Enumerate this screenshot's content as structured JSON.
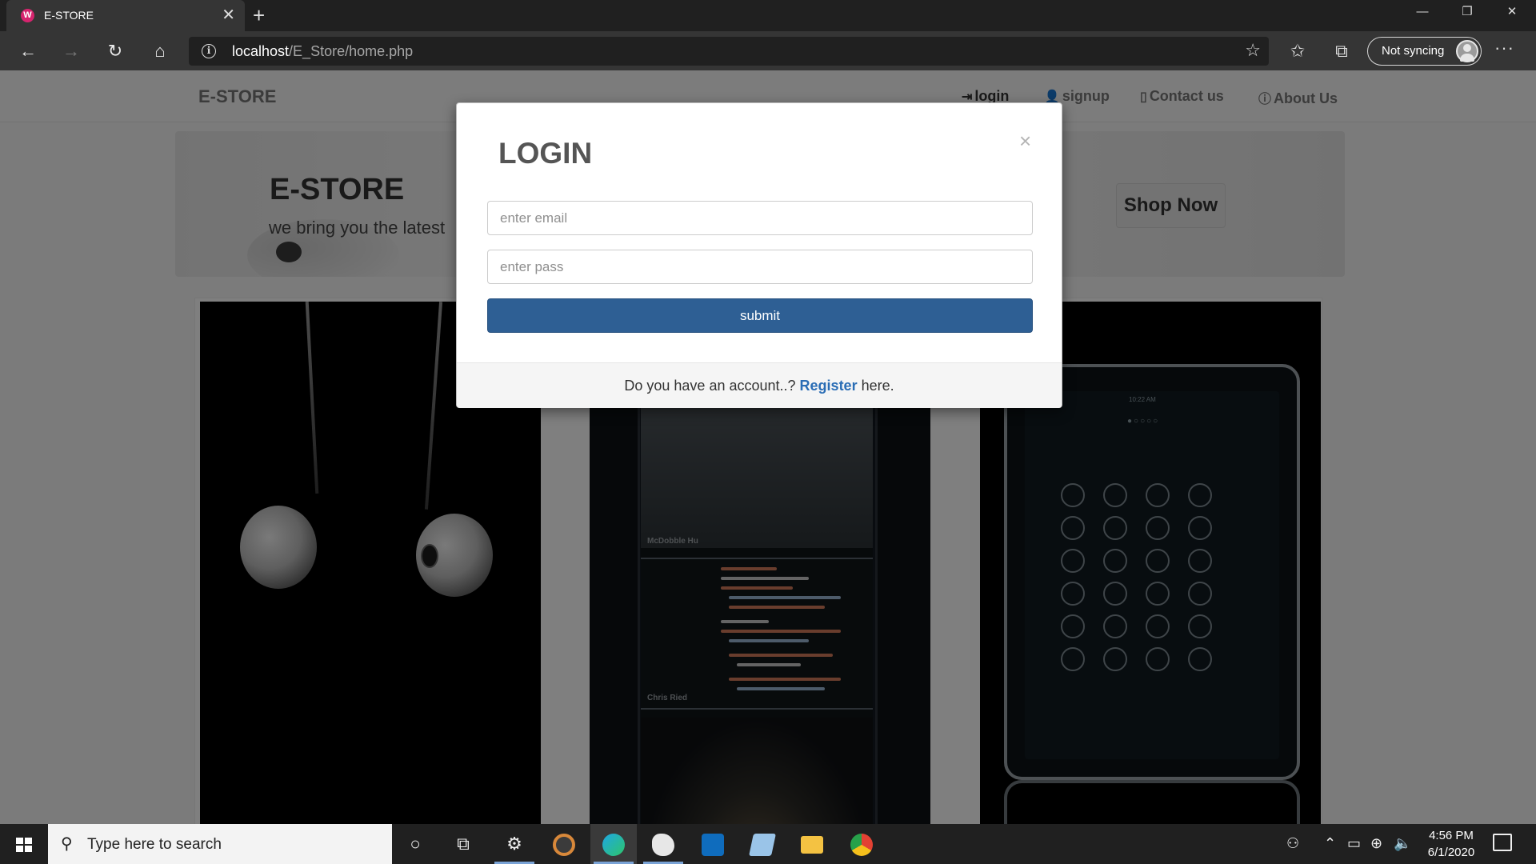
{
  "browser": {
    "tab_title": "E-STORE",
    "favicon_letter": "W",
    "url_host": "localhost",
    "url_path": "/E_Store/home.php",
    "sync_label": "Not syncing"
  },
  "site": {
    "brand": "E-STORE",
    "nav": [
      {
        "label": "login"
      },
      {
        "label": "signup"
      },
      {
        "label": "Contact us"
      },
      {
        "label": "About Us"
      }
    ],
    "hero": {
      "title": "E-STORE",
      "subtitle": "we bring you the latest",
      "cta": "Shop Now"
    },
    "products": {
      "phone_captions": [
        "McDobble Hu",
        "Chris Ried"
      ],
      "tablet_status_time": "10:22 AM"
    }
  },
  "modal": {
    "title": "LOGIN",
    "close": "×",
    "email_placeholder": "enter email",
    "pass_placeholder": "enter pass",
    "submit_label": "submit",
    "footer_prefix": "Do you have an account..?",
    "register_link": "Register",
    "footer_suffix": "here."
  },
  "taskbar": {
    "search_placeholder": "Type here to search",
    "time": "4:56 PM",
    "date": "6/1/2020",
    "apps": [
      {
        "name": "cortana-icon",
        "color": "#eeeeee"
      },
      {
        "name": "task-view-icon",
        "color": "#eeeeee"
      },
      {
        "name": "settings-icon",
        "color": "#eeeeee"
      },
      {
        "name": "media-app-icon",
        "color": "#d8883a"
      },
      {
        "name": "edge-icon",
        "color": "#1ea7e4"
      },
      {
        "name": "paint-icon",
        "color": "#e7e7e7"
      },
      {
        "name": "outlook-icon",
        "color": "#0f6cbd"
      },
      {
        "name": "edu-app-icon",
        "color": "#9ac4e8"
      },
      {
        "name": "file-explorer-icon",
        "color": "#f4c242"
      },
      {
        "name": "chrome-icon",
        "color": "#e34133"
      }
    ]
  }
}
